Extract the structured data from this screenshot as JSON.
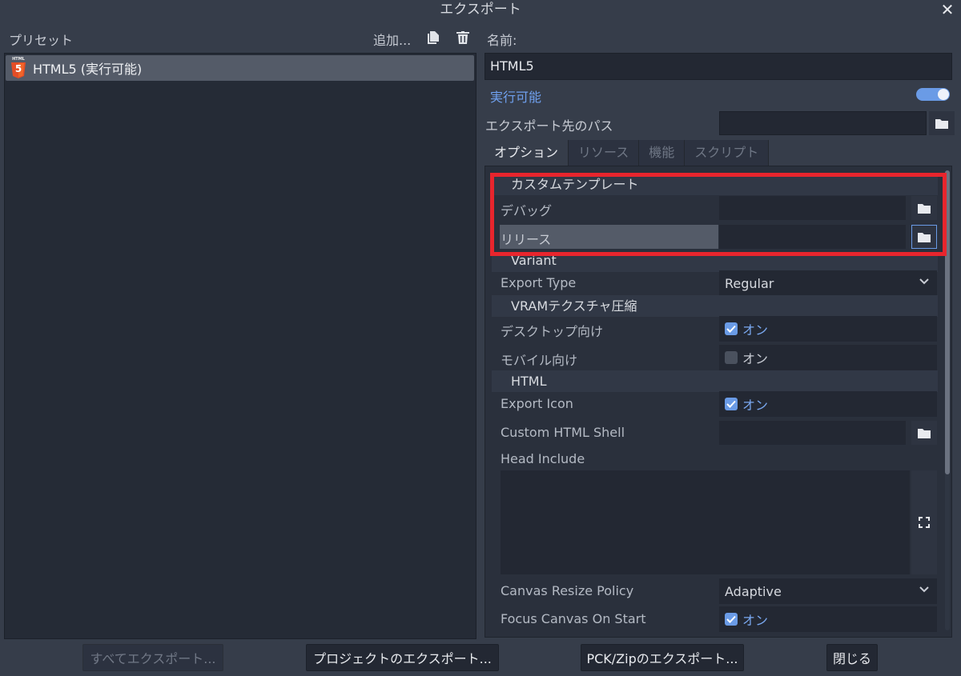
{
  "window": {
    "title": "エクスポート"
  },
  "left": {
    "header_label": "プリセット",
    "add_label": "追加...",
    "presets": [
      {
        "label": "HTML5 (実行可能)",
        "badge": "HTML",
        "badge_num": "5"
      }
    ]
  },
  "right": {
    "name_label": "名前:",
    "name_value": "HTML5",
    "runnable_label": "実行可能",
    "export_path_label": "エクスポート先のパス",
    "export_path_value": "",
    "tabs": [
      "オプション",
      "リソース",
      "機能",
      "スクリプト"
    ],
    "options": {
      "custom_template": {
        "section": "カスタムテンプレート",
        "debug_label": "デバッグ",
        "release_label": "リリース"
      },
      "variant": {
        "section": "Variant",
        "export_type_label": "Export Type",
        "export_type_value": "Regular"
      },
      "vram": {
        "section": "VRAMテクスチャ圧縮",
        "desktop_label": "デスクトップ向け",
        "desktop_value": "オン",
        "mobile_label": "モバイル向け",
        "mobile_value": "オン"
      },
      "html": {
        "section": "HTML",
        "export_icon_label": "Export Icon",
        "export_icon_value": "オン",
        "custom_shell_label": "Custom HTML Shell",
        "head_include_label": "Head Include",
        "canvas_resize_label": "Canvas Resize Policy",
        "canvas_resize_value": "Adaptive",
        "focus_canvas_label": "Focus Canvas On Start",
        "focus_canvas_value": "オン"
      }
    }
  },
  "footer": {
    "export_all": "すべてエクスポート...",
    "export_project": "プロジェクトのエクスポート...",
    "export_pck": "PCK/Zipのエクスポート...",
    "close": "閉じる"
  },
  "colors": {
    "accent": "#6a9be6",
    "highlight": "#e8252d",
    "background": "#363d4a"
  }
}
